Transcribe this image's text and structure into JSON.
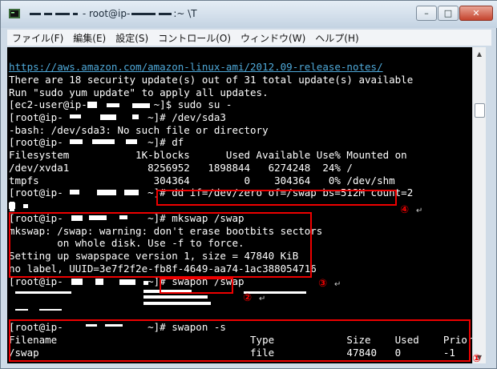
{
  "window": {
    "title_prefix": "- root@ip-",
    "title_suffix": ":~ \\T",
    "btn_minimize": "–",
    "btn_maximize": "□",
    "btn_close": "✕"
  },
  "menu": [
    {
      "label": "ファイル(F)"
    },
    {
      "label": "編集(E)"
    },
    {
      "label": "設定(S)"
    },
    {
      "label": "コントロール(O)"
    },
    {
      "label": "ウィンドウ(W)"
    },
    {
      "label": "ヘルプ(H)"
    }
  ],
  "terminal": {
    "lines": [
      "https://aws.amazon.com/amazon-linux-ami/2012.09-release-notes/",
      "There are 18 security update(s) out of 31 total update(s) available",
      "Run \"sudo yum update\" to apply all updates.",
      "[ec2-user@ip-           ~]$ sudo su -",
      "[root@ip-              ~]# /dev/sda3",
      "-bash: /dev/sda3: No such file or directory",
      "[root@ip-              ~]# df",
      "Filesystem           1K-blocks      Used Available Use% Mounted on",
      "/dev/xvda1             8256952   1898844   6274248  24% /",
      "tmpfs                   304364         0    304364   0% /dev/shm",
      "[root@ip-              ~]# dd if=/dev/zero of=/swap bs=512M count=2",
      "",
      "[root@ip-              ~]# mkswap /swap",
      "mkswap: /swap: warning: don't erase bootbits sectors",
      "        on whole disk. Use -f to force.",
      "Setting up swapspace version 1, size = 47840 KiB",
      "no label, UUID=3e7f2f2e-fb8f-4649-aa74-1ac388054716",
      "[root@ip-              ~]# swapon /swap",
      "",
      "",
      "[root@ip-              ~]# swapon -s",
      "Filename                                Type            Size    Used    Priority",
      "/swap                                   file            47840   0       -1"
    ]
  },
  "annotations": {
    "m1": "①",
    "m2": "②",
    "m3": "③",
    "m4": "④",
    "return_mark": "↵"
  },
  "colors": {
    "annotation": "#e00000",
    "link": "#4fa9d9",
    "terminal_bg": "#000000",
    "terminal_fg": "#ffffff"
  }
}
